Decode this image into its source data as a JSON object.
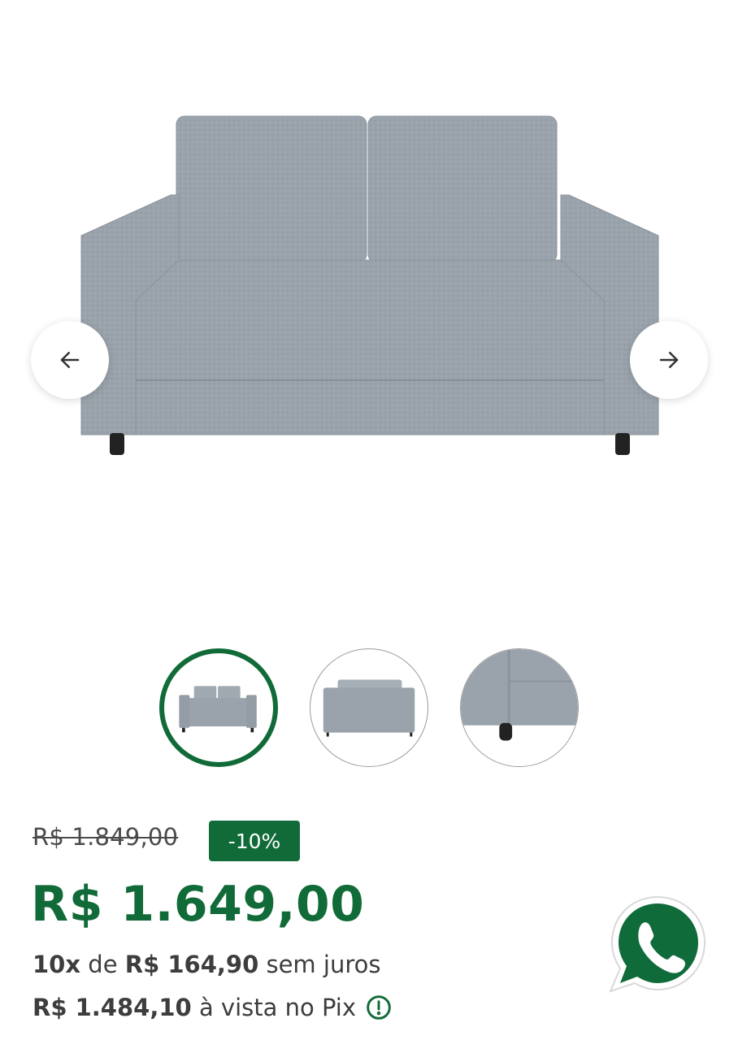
{
  "gallery": {
    "image_name": "sofa-photo",
    "prev_icon": "arrow-left-icon",
    "next_icon": "arrow-right-icon",
    "thumbnails": [
      {
        "name": "thumb-front",
        "active": true
      },
      {
        "name": "thumb-back",
        "active": false
      },
      {
        "name": "thumb-detail",
        "active": false
      }
    ]
  },
  "pricing": {
    "old_price": "R$ 1.849,00",
    "discount": "-10%",
    "price": "R$ 1.649,00",
    "installments": {
      "count": "10x",
      "of": "de",
      "amount": "R$ 164,90",
      "suffix": "sem juros"
    },
    "pix": {
      "amount": "R$ 1.484,10",
      "suffix": "à vista no Pix"
    }
  },
  "colors": {
    "brand_green": "#116b38",
    "whatsapp_green": "#0f6b39"
  },
  "whatsapp_icon": "whatsapp-icon"
}
